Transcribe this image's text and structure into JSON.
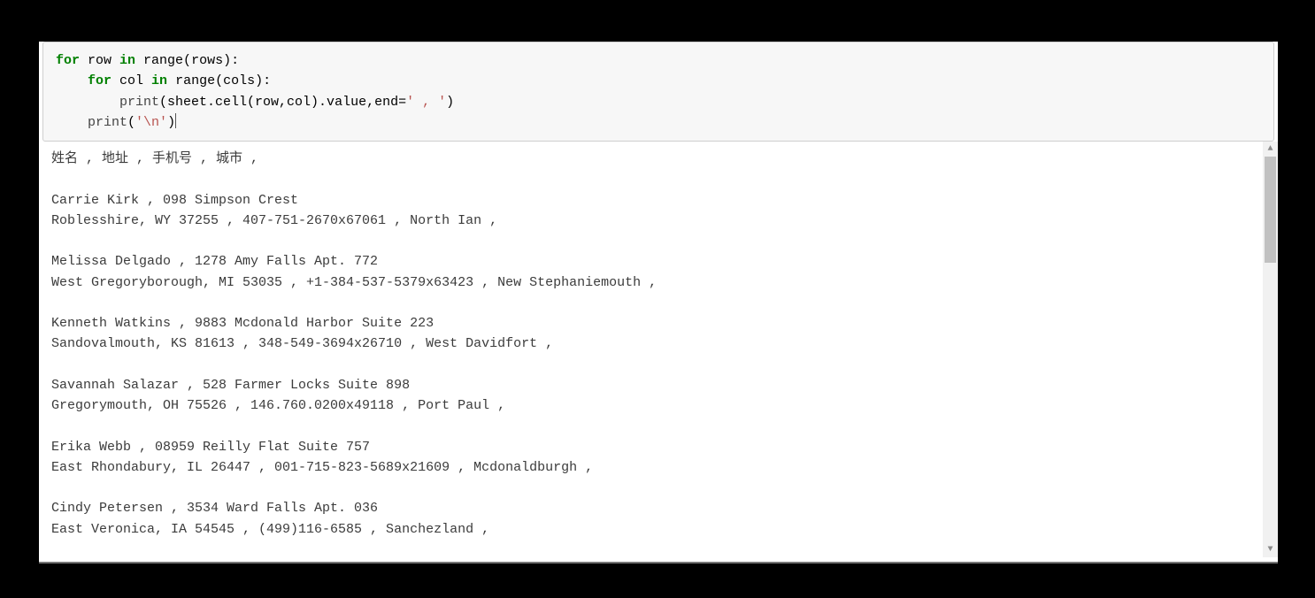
{
  "code": {
    "line1": {
      "kw_for": "for",
      "row": " row ",
      "kw_in": "in",
      "range_open": " range(",
      "arg": "rows",
      "close": "):"
    },
    "line2": {
      "indent": "    ",
      "kw_for": "for",
      "col": " col ",
      "kw_in": "in",
      "range_open": " range(",
      "arg": "cols",
      "close": "):"
    },
    "line3": {
      "indent": "        ",
      "fn": "print",
      "open": "(sheet.cell(row,col).value,end=",
      "str": "' , '",
      "close": ")"
    },
    "line4": {
      "indent": "    ",
      "fn": "print",
      "open": "(",
      "str": "'\\n'",
      "close": ")"
    }
  },
  "output": {
    "header": "姓名 , 地址 , 手机号 , 城市 , ",
    "records": [
      {
        "line1": "Carrie Kirk , 098 Simpson Crest",
        "line2": "Roblesshire, WY 37255 , 407-751-2670x67061 , North Ian , "
      },
      {
        "line1": "Melissa Delgado , 1278 Amy Falls Apt. 772",
        "line2": "West Gregoryborough, MI 53035 , +1-384-537-5379x63423 , New Stephaniemouth , "
      },
      {
        "line1": "Kenneth Watkins , 9883 Mcdonald Harbor Suite 223",
        "line2": "Sandovalmouth, KS 81613 , 348-549-3694x26710 , West Davidfort , "
      },
      {
        "line1": "Savannah Salazar , 528 Farmer Locks Suite 898",
        "line2": "Gregorymouth, OH 75526 , 146.760.0200x49118 , Port Paul , "
      },
      {
        "line1": "Erika Webb , 08959 Reilly Flat Suite 757",
        "line2": "East Rhondabury, IL 26447 , 001-715-823-5689x21609 , Mcdonaldburgh , "
      },
      {
        "line1": "Cindy Petersen , 3534 Ward Falls Apt. 036",
        "line2": "East Veronica, IA 54545 , (499)116-6585 , Sanchezland , "
      }
    ]
  },
  "scrollbar": {
    "up": "▲",
    "down": "▼"
  },
  "watermark": ""
}
